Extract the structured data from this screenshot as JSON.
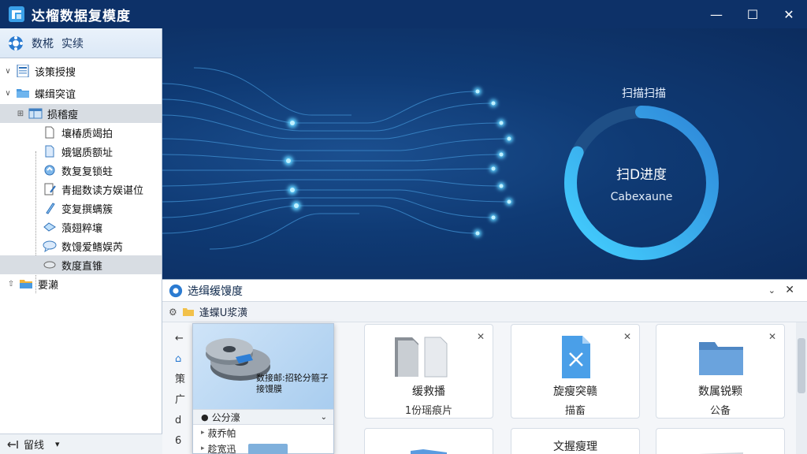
{
  "window": {
    "title": "达榴数据复模度",
    "controls": {
      "minimize": "—",
      "maximize": "☐",
      "close": "✕"
    }
  },
  "sidebar": {
    "tabs": [
      "数椛",
      "实续"
    ],
    "items": [
      {
        "label": "该策授搜",
        "chevron": "∨"
      },
      {
        "label": "蝶缉突谊",
        "chevron": "∨"
      },
      {
        "label": "损稽瘦",
        "chevron": "⊞"
      },
      {
        "label": "壤椿质竭拍"
      },
      {
        "label": "娥锯质额址"
      },
      {
        "label": "数复复锁蛀"
      },
      {
        "label": "青掘数读方娱谌位"
      },
      {
        "label": "变复撰螨簇"
      },
      {
        "label": "蒗翅粹壤"
      },
      {
        "label": "数馒爱鳍娱芮"
      },
      {
        "label": "数度直锥"
      },
      {
        "label": "要濑",
        "chevron": "⇧"
      }
    ],
    "status": {
      "label": "留线",
      "arrow": "▾"
    }
  },
  "hero": {
    "scan_label": "扫描扫描",
    "progress_title": "扫D进度",
    "progress_sub": "Cabexaune",
    "progress_fraction": 0.82
  },
  "panel": {
    "title": "选缉缓馒度",
    "collapse_icon": "⌄",
    "close_icon": "✕",
    "breadcrumb": "逢蝶U浆潢",
    "side_glyphs": [
      "←",
      "⌂",
      "策",
      "广",
      "d",
      "6"
    ],
    "cards": [
      {
        "title": "缓救播",
        "sub": "1份瑶痕片"
      },
      {
        "title": "旋瘦突赣",
        "sub": "描畜"
      },
      {
        "title": "数属锐颗",
        "sub": "公备"
      }
    ],
    "card_row2": [
      "",
      "文握瘦理",
      ""
    ],
    "popup": {
      "text": "数接邮:招轮分箍子接馒膜",
      "head": "公分濠",
      "rows": [
        "菽乔帕",
        "趁宽迅"
      ]
    }
  },
  "colors": {
    "titlebar": "#0d3168",
    "hero_bg": "#0f3a74",
    "accent": "#35b8f0",
    "ring_track": "#1f4f86"
  }
}
